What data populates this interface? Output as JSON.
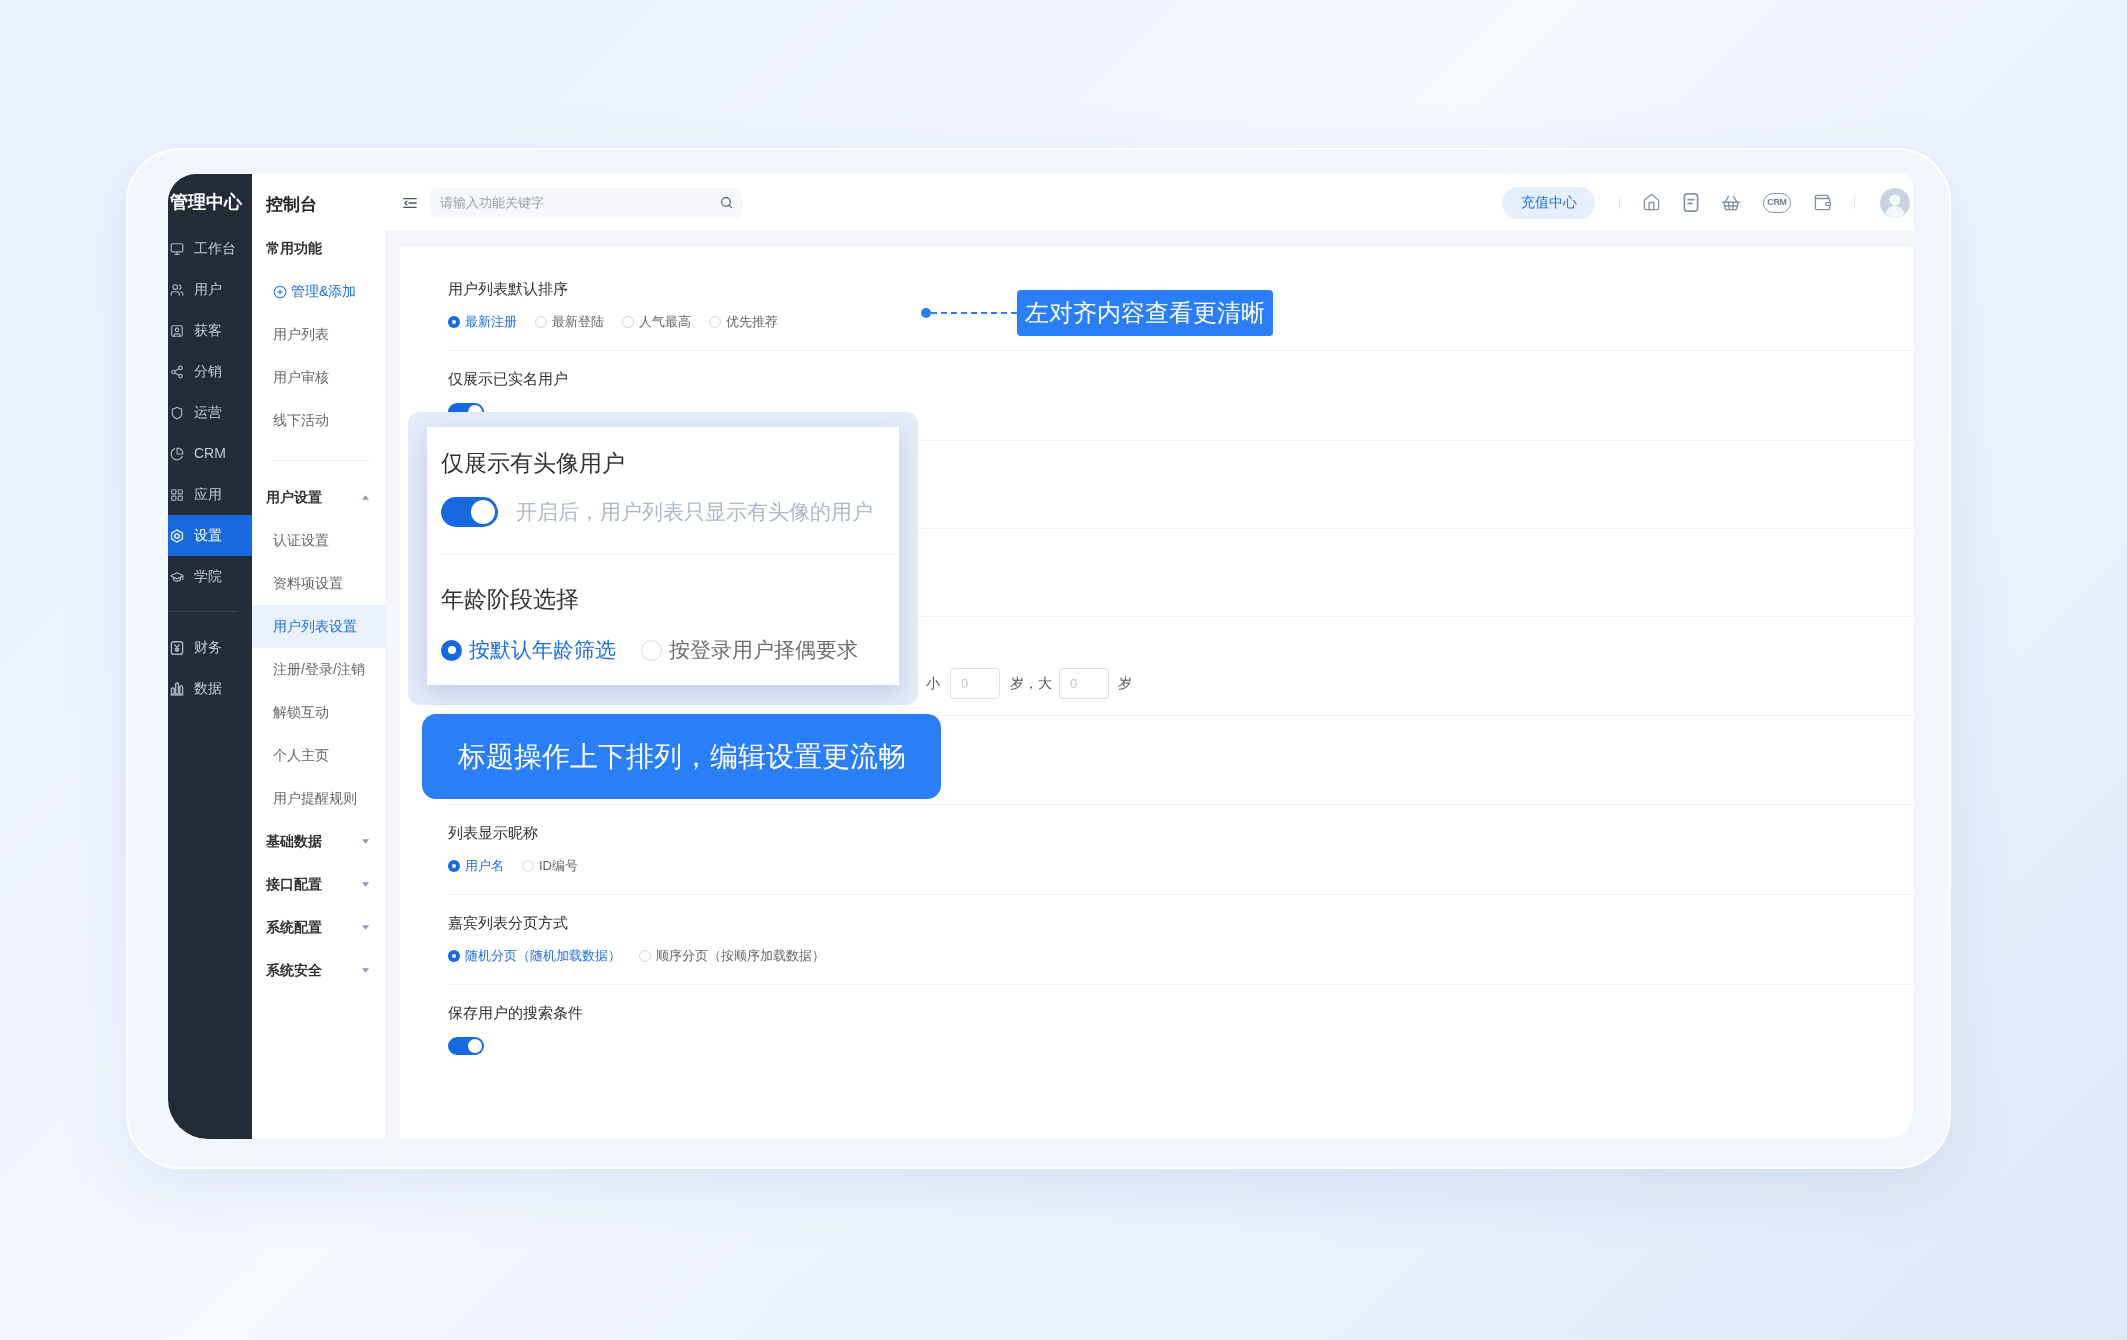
{
  "sidebar": {
    "title": "管理中心",
    "sections": [
      {
        "items": [
          {
            "label": "工作台",
            "selected": false
          },
          {
            "label": "用户",
            "selected": false
          },
          {
            "label": "获客",
            "selected": false
          },
          {
            "label": "分销",
            "selected": false
          },
          {
            "label": "运营",
            "selected": false
          },
          {
            "label": "CRM",
            "selected": false
          },
          {
            "label": "应用",
            "selected": false
          },
          {
            "label": "设置",
            "selected": true
          },
          {
            "label": "学院",
            "selected": false
          }
        ]
      },
      {
        "items": [
          {
            "label": "财务",
            "selected": false
          },
          {
            "label": "数据",
            "selected": false
          }
        ]
      }
    ]
  },
  "subnav": {
    "title": "控制台",
    "sections": [
      {
        "heading": "常用功能",
        "kind": "fixed",
        "items": [
          {
            "kind": "action",
            "label": "管理&添加",
            "selected": false
          },
          {
            "kind": "link",
            "label": "用户列表",
            "selected": false
          },
          {
            "kind": "link",
            "label": "用户审核",
            "selected": false
          },
          {
            "kind": "link",
            "label": "线下活动",
            "selected": false
          }
        ]
      },
      {
        "heading": "用户设置",
        "kind": "collapsible",
        "expanded": true,
        "items": [
          {
            "kind": "link",
            "label": "认证设置",
            "selected": false
          },
          {
            "kind": "link",
            "label": "资料项设置",
            "selected": false
          },
          {
            "kind": "link",
            "label": "用户列表设置",
            "selected": true
          },
          {
            "kind": "link",
            "label": "注册/登录/注销",
            "selected": false
          },
          {
            "kind": "link",
            "label": "解锁互动",
            "selected": false
          },
          {
            "kind": "link",
            "label": "个人主页",
            "selected": false
          },
          {
            "kind": "link",
            "label": "用户提醒规则",
            "selected": false
          }
        ]
      },
      {
        "heading": "基础数据",
        "kind": "collapsible",
        "expanded": false
      },
      {
        "heading": "接口配置",
        "kind": "collapsible",
        "expanded": false
      },
      {
        "heading": "系统配置",
        "kind": "collapsible",
        "expanded": false
      },
      {
        "heading": "系统安全",
        "kind": "collapsible",
        "expanded": false
      }
    ]
  },
  "topbar": {
    "search": {
      "placeholder": "请输入功能关键字"
    },
    "recharge_button": "充值中心",
    "crm_icon_label": "CRM"
  },
  "settings_top": [
    {
      "kind": "radio",
      "title": "用户列表默认排序",
      "options": [
        {
          "label": "最新注册",
          "selected": true
        },
        {
          "label": "最新登陆",
          "selected": false
        },
        {
          "label": "人气最高",
          "selected": false
        },
        {
          "label": "优先推荐",
          "selected": false
        }
      ]
    },
    {
      "kind": "toggle",
      "title": "仅展示已实名用户",
      "on": true
    }
  ],
  "annotation": {
    "text": "左对齐内容查看更清晰"
  },
  "callout_card": {
    "toggle_setting": {
      "title": "仅展示有头像用户",
      "on": true,
      "hint": "开启后，用户列表只显示有头像的用户"
    },
    "radio_setting": {
      "title": "年龄阶段选择",
      "options": [
        {
          "label": "按默认年龄筛选",
          "selected": true
        },
        {
          "label": "按登录用户择偶要求",
          "selected": false
        }
      ]
    }
  },
  "age_range": {
    "prefix": "小",
    "min": {
      "placeholder": "0"
    },
    "middle": "岁，大",
    "max": {
      "placeholder": "0"
    },
    "suffix": "岁"
  },
  "banner": {
    "text": "标题操作上下排列，编辑设置更流畅"
  },
  "settings_bottom": [
    {
      "kind": "radio",
      "title": "列表显示昵称",
      "options": [
        {
          "label": "用户名",
          "selected": true
        },
        {
          "label": "ID编号",
          "selected": false
        }
      ]
    },
    {
      "kind": "radio",
      "title": "嘉宾列表分页方式",
      "options": [
        {
          "label": "随机分页（随机加载数据）",
          "selected": true
        },
        {
          "label": "顺序分页（按顺序加载数据）",
          "selected": false
        }
      ]
    },
    {
      "kind": "toggle",
      "title": "保存用户的搜索条件",
      "on": true
    }
  ]
}
